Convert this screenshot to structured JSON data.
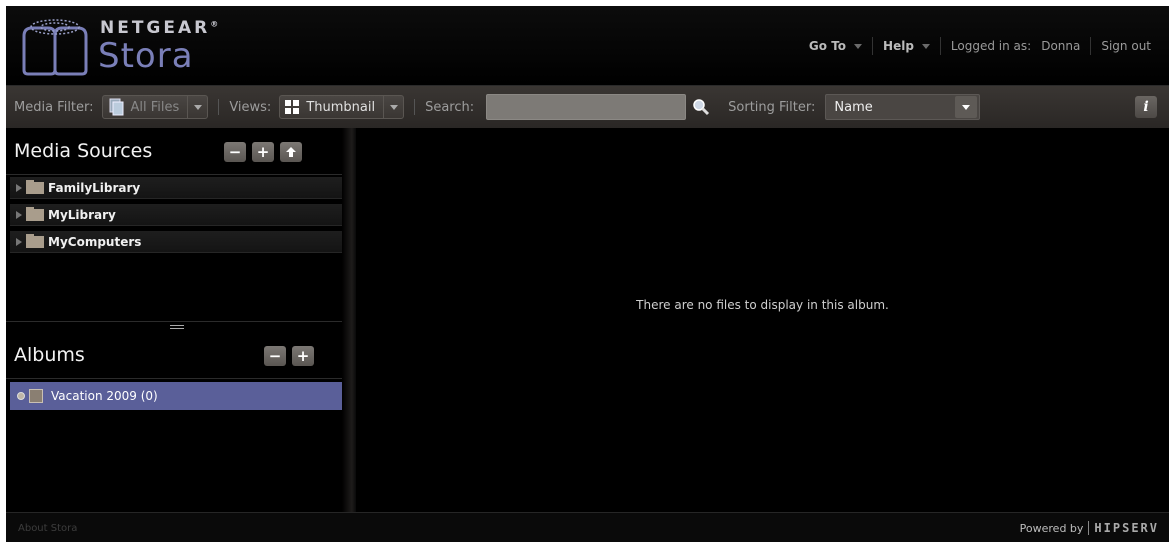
{
  "header": {
    "brand": "NETGEAR",
    "brand_mark": "®",
    "product": "Stora",
    "nav": {
      "goto_label": "Go To",
      "help_label": "Help",
      "logged_in_label": "Logged in as:",
      "username": "Donna",
      "signout_label": "Sign out"
    }
  },
  "toolbar": {
    "media_filter_label": "Media Filter:",
    "media_filter_value": "All Files",
    "views_label": "Views:",
    "views_value": "Thumbnail",
    "search_label": "Search:",
    "search_value": "",
    "sorting_label": "Sorting Filter:",
    "sorting_value": "Name",
    "info_label": "i"
  },
  "sidebar": {
    "media_sources_title": "Media Sources",
    "media_sources": [
      {
        "label": "FamilyLibrary"
      },
      {
        "label": "MyLibrary"
      },
      {
        "label": "MyComputers"
      }
    ],
    "albums_title": "Albums",
    "albums": [
      {
        "label": "Vacation 2009 (0)",
        "selected": true
      }
    ]
  },
  "main": {
    "empty_message": "There are no files to display in this album."
  },
  "footer": {
    "about_label": "About Stora",
    "powered_label": "Powered by",
    "powered_brand": "HIPSERV"
  },
  "colors": {
    "selected_album": "#5a5f99",
    "logo_accent": "#7a7fb8"
  },
  "icons": [
    "stora-logo-icon",
    "chevron-down-icon",
    "document-icon",
    "grid-icon",
    "search-icon",
    "info-icon",
    "minus-icon",
    "plus-icon",
    "up-arrow-icon",
    "expand-arrow-icon",
    "folder-icon",
    "radio-icon",
    "album-thumb-icon",
    "resize-grip-icon"
  ]
}
